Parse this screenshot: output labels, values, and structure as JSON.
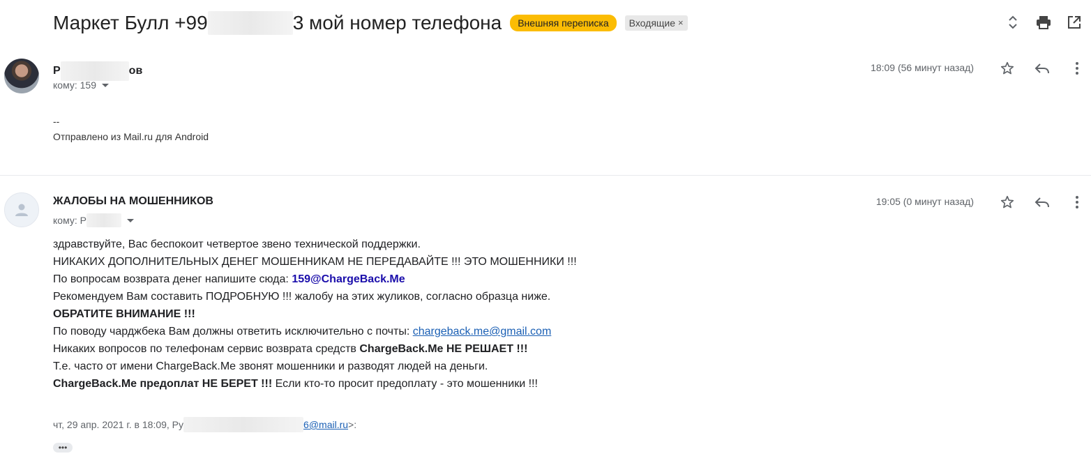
{
  "thread": {
    "subject_start": "Маркет Булл +99",
    "subject_end": "3 мой номер телефона",
    "label_external": "Внешняя переписка",
    "label_inbox": "Входящие",
    "label_inbox_remove": "×"
  },
  "messages": [
    {
      "sender_start": "Р",
      "sender_end": "ов",
      "to_prefix": "кому: 159",
      "time": "18:09 (56 минут назад)",
      "body": {
        "sig_dash": "--",
        "sig_text": "Отправлено из Mail.ru для Android"
      }
    },
    {
      "sender": "ЖАЛОБЫ НА МОШЕННИКОВ",
      "to_prefix": "кому: Р",
      "time": "19:05 (0 минут назад)",
      "body": {
        "line1": "здравствуйте, Вас беспокоит четвертое звено технической поддержки.",
        "line2": "НИКАКИХ ДОПОЛНИТЕЛЬНЫХ ДЕНЕГ МОШЕННИКАМ НЕ ПЕРЕДАВАЙТЕ !!! ЭТО МОШЕННИКИ !!!",
        "line3_prefix": "По вопросам возврата денег напишите сюда: ",
        "line3_email": "159@ChargeBack.Me",
        "line4": "Рекомендуем Вам составить ПОДРОБНУЮ !!! жалобу на этих жуликов, согласно образца ниже.",
        "line5": "ОБРАТИТЕ ВНИМАНИЕ !!!",
        "line6_prefix": "По поводу чарджбека Вам должны ответить исключительно с почты: ",
        "line6_link": "chargeback.me@gmail.com",
        "line7_prefix": "Никаких вопросов по телефонам сервис возврата средств ",
        "line7_bold": "ChargeBack.Me НЕ РЕШАЕТ !!!",
        "line8": "Т.е. часто от имени ChargeBack.Me звонят мошенники и разводят людей на деньги.",
        "line9_bold": "ChargeBack.Me предоплат НЕ БЕРЕТ !!!",
        "line9_rest": " Если кто-то просит предоплату - это мошенники !!!"
      },
      "quote_prefix": "чт, 29 апр. 2021 г. в 18:09, Ру",
      "quote_email_end": "6@mail.ru",
      "quote_suffix": ">:",
      "ellipsis": "•••"
    }
  ],
  "icons": {
    "top": [
      "expand-collapse-icon",
      "print-icon",
      "open-in-new-window-icon"
    ],
    "message": [
      "star-icon",
      "reply-icon",
      "more-vert-icon"
    ]
  }
}
